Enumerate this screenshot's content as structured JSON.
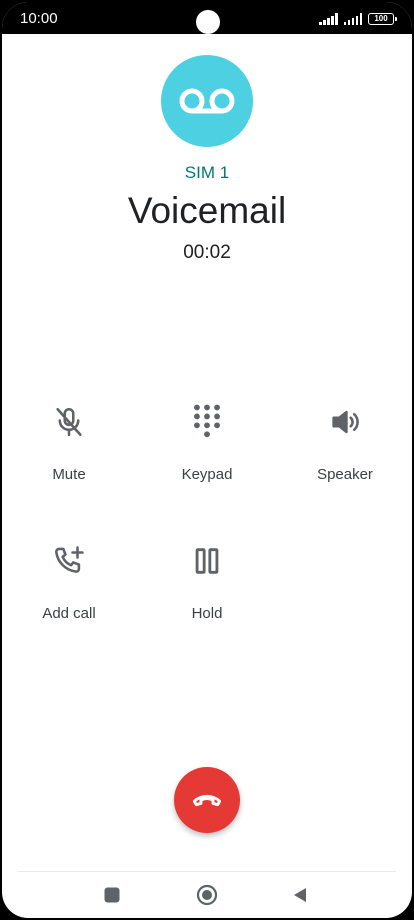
{
  "status_bar": {
    "time": "10:00",
    "battery": "100"
  },
  "call": {
    "sim": "SIM 1",
    "name": "Voicemail",
    "timer": "00:02",
    "avatar_icon": "voicemail-icon"
  },
  "controls": [
    {
      "label": "Mute",
      "icon": "mic-off-icon"
    },
    {
      "label": "Keypad",
      "icon": "dialpad-icon"
    },
    {
      "label": "Speaker",
      "icon": "volume-icon"
    },
    {
      "label": "Add call",
      "icon": "add-call-icon"
    },
    {
      "label": "Hold",
      "icon": "pause-icon"
    }
  ],
  "end_call": {
    "icon": "end-call-icon"
  },
  "nav": [
    "recents-icon",
    "home-icon",
    "back-icon"
  ],
  "colors": {
    "accent": "#4dd0e1",
    "sim_text": "#00796b",
    "end_call": "#e53935",
    "icon_gray": "#5f6368"
  }
}
